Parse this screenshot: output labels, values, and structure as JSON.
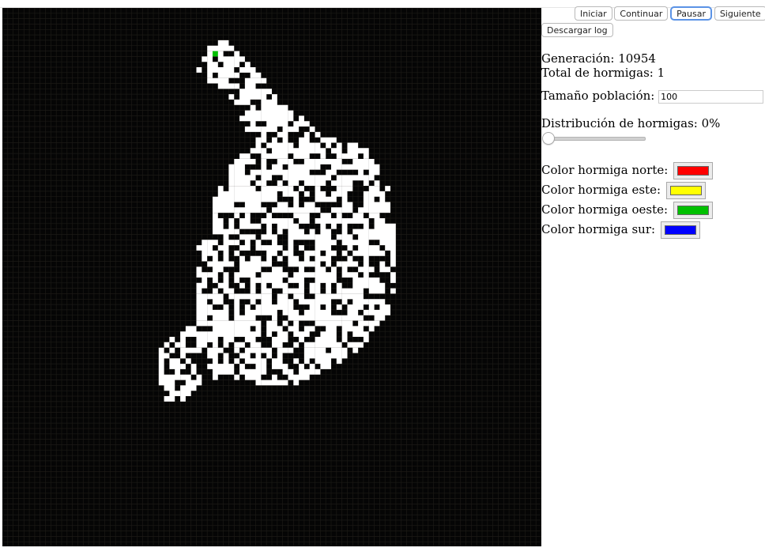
{
  "controls": {
    "start_label": "Iniciar",
    "continue_label": "Continuar",
    "pause_label": "Pausar",
    "next_label": "Siguiente",
    "download_label": "Descargar log"
  },
  "stats": {
    "generation": "Generación: 10954",
    "total_ants": "Total de hormigas: 1"
  },
  "population": {
    "label": "Tamaño población:",
    "value": "100"
  },
  "distribution": {
    "label": "Distribución de hormigas: 0%",
    "value": 0
  },
  "colors": {
    "north_label": "Color hormiga norte:",
    "north": "#ff0000",
    "east_label": "Color hormiga este:",
    "east": "#ffff00",
    "west_label": "Color hormiga oeste:",
    "west": "#00c000",
    "south_label": "Color hormiga sur:",
    "south": "#0000ff"
  }
}
